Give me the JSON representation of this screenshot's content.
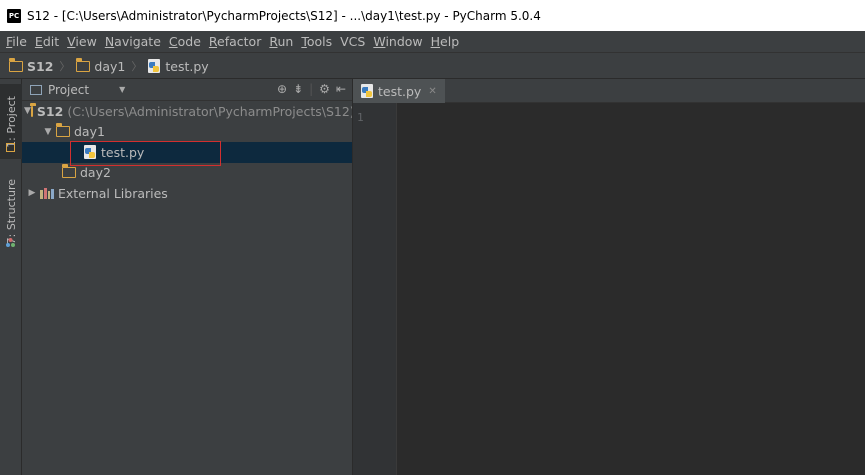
{
  "window": {
    "app_icon_text": "PC",
    "title": "S12 - [C:\\Users\\Administrator\\PycharmProjects\\S12] - ...\\day1\\test.py - PyCharm 5.0.4"
  },
  "menu": {
    "items": [
      {
        "mnemonic": "F",
        "rest": "ile"
      },
      {
        "mnemonic": "E",
        "rest": "dit"
      },
      {
        "mnemonic": "V",
        "rest": "iew"
      },
      {
        "mnemonic": "N",
        "rest": "avigate"
      },
      {
        "mnemonic": "C",
        "rest": "ode"
      },
      {
        "mnemonic": "R",
        "rest": "efactor"
      },
      {
        "mnemonic": "R",
        "rest": "un"
      },
      {
        "mnemonic": "T",
        "rest": "ools"
      },
      {
        "mnemonic": "",
        "rest": "VCS"
      },
      {
        "mnemonic": "W",
        "rest": "indow"
      },
      {
        "mnemonic": "H",
        "rest": "elp"
      }
    ]
  },
  "breadcrumb": {
    "project": "S12",
    "folder": "day1",
    "file": "test.py"
  },
  "tool_windows": {
    "project_tab": "1: Project",
    "structure_tab": "7: Structure"
  },
  "project_panel": {
    "selector_label": "Project",
    "root_name": "S12",
    "root_path": "(C:\\Users\\Administrator\\PycharmProjects\\S12)",
    "day1": "day1",
    "file": "test.py",
    "day2": "day2",
    "external": "External Libraries"
  },
  "editor": {
    "tab_label": "test.py",
    "line_number": "1"
  },
  "colors": {
    "accent_highlight": "#d22f2f",
    "selection": "#0d293e",
    "folder": "#d9a443"
  }
}
